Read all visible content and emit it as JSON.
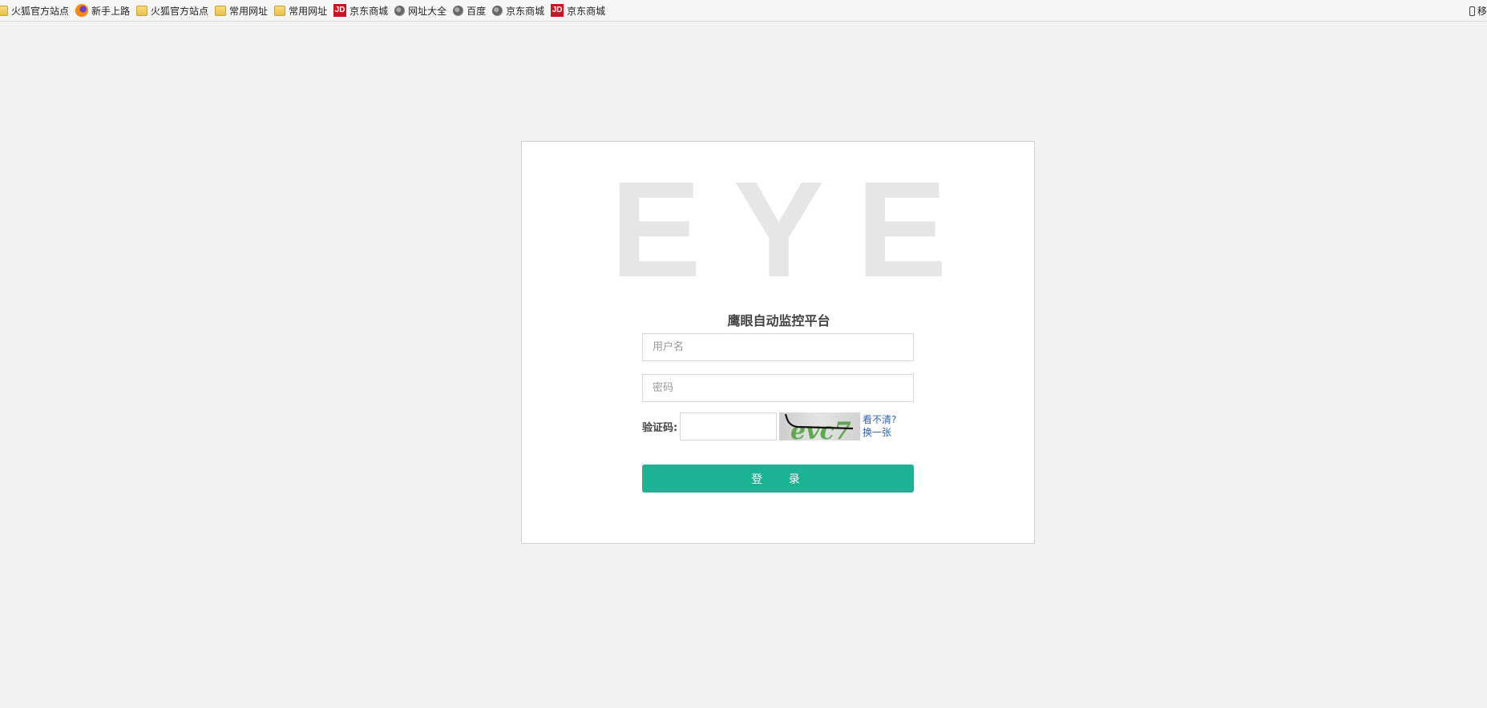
{
  "bookmarks": [
    {
      "label": "火狐官方站点",
      "icon": "folder-icon"
    },
    {
      "label": "新手上路",
      "icon": "firefox-icon"
    },
    {
      "label": "火狐官方站点",
      "icon": "folder-icon"
    },
    {
      "label": "常用网址",
      "icon": "folder-icon"
    },
    {
      "label": "常用网址",
      "icon": "folder-icon"
    },
    {
      "label": "京东商城",
      "icon": "jd-icon"
    },
    {
      "label": "网址大全",
      "icon": "globe-icon"
    },
    {
      "label": "百度",
      "icon": "globe-icon"
    },
    {
      "label": "京东商城",
      "icon": "globe-icon"
    },
    {
      "label": "京东商城",
      "icon": "jd-icon"
    }
  ],
  "bookmarks_right": {
    "label": "移",
    "icon": "mobile-icon"
  },
  "jd_icon_text": "JD",
  "login": {
    "logo_text": "EYE",
    "title": "鹰眼自动监控平台",
    "username_placeholder": "用户名",
    "password_placeholder": "密码",
    "captcha_label": "验证码:",
    "captcha_code": "evc7",
    "captcha_unclear": "看不清?",
    "captcha_refresh": "换一张",
    "submit_label": "登 录"
  },
  "colors": {
    "background": "#f2f2f2",
    "accent": "#1bb394",
    "link": "#2a64b4",
    "logo": "#e6e6e6"
  }
}
